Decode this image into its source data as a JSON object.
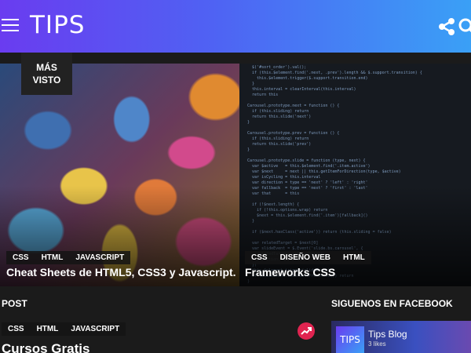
{
  "header": {
    "logo": "TIPS",
    "gradient": [
      "#6a3cf0",
      "#3aa0f6"
    ]
  },
  "hero": {
    "badge": [
      "MÁS",
      "VISTO"
    ],
    "left": {
      "tags": [
        "CSS",
        "HTML",
        "JAVASCRIPT"
      ],
      "title": "Cheat Sheets de HTML5, CSS3 y Javascript."
    },
    "right": {
      "tags": [
        "CSS",
        "DISEÑO WEB",
        "HTML"
      ],
      "title": "Frameworks CSS"
    }
  },
  "post_section": {
    "title": "POST",
    "tags": [
      "CSS",
      "HTML",
      "JAVASCRIPT"
    ],
    "heading": "Cursos Gratis",
    "accent": "#e02450"
  },
  "facebook": {
    "title": "SIGUENOS EN FACEBOOK",
    "page_name": "Tips Blog",
    "likes": "3 likes",
    "avatar_text": "TIPS"
  }
}
